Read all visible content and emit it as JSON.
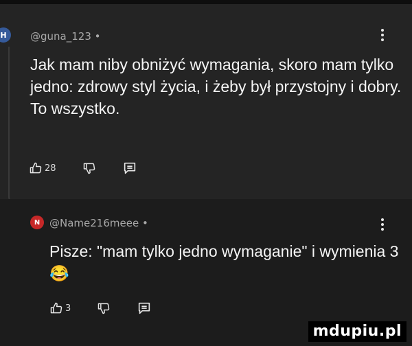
{
  "comments": [
    {
      "avatar_initial": "H",
      "handle": "@guna_123 •",
      "text": "Jak mam niby obniżyć wymagania, skoro mam tylko jedno: zdrowy styl życia, i żeby był przystojny i dobry. To wszystko.",
      "likes": "28"
    },
    {
      "avatar_initial": "N",
      "handle": "@Name216meee •",
      "text": "Pisze: \"mam tylko jedno wymaganie\" i wymienia 3",
      "emoji": "😂",
      "likes": "3"
    }
  ],
  "icons": {
    "like": "thumb-up-icon",
    "dislike": "thumb-down-icon",
    "reply": "reply-comment-icon",
    "menu": "more-vertical-icon"
  },
  "colors": {
    "background": "#1b1b1b",
    "highlighted_comment": "#242424",
    "avatar_n": "#c62828"
  },
  "watermark": {
    "text": "mdupiu.pl"
  }
}
